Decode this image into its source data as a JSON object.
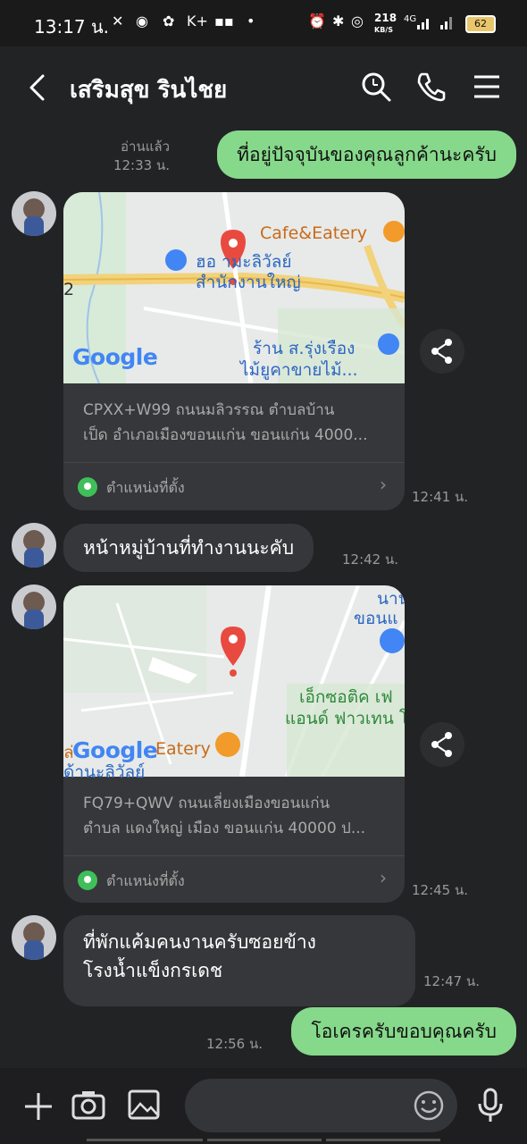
{
  "status_bar": {
    "time": "13:17 น.",
    "net_speed": "218",
    "net_speed_unit": "KB/S",
    "net_type": "4G",
    "battery": "62"
  },
  "header": {
    "title": "เสริมสุข   รินไชย"
  },
  "messages": {
    "m1": {
      "text": "ที่อยู่ปัจจุบันของคุณลูกค้านะครับ",
      "read": "อ่านแล้ว",
      "time": "12:33 น."
    },
    "m2": {
      "address_line1": "CPXX+W99 ถนนมลิวรรณ ตำบลบ้าน",
      "address_line2": "เป็ด อำเภอเมืองขอนแก่น ขอนแก่น 4000...",
      "location_label": "ตำแหน่งที่ตั้ง",
      "time": "12:41 น.",
      "map_labels": {
        "cafe": "Cafe&Eatery",
        "place1a": "ฮอ  ามะลิวัลย์",
        "place1b": "สำนักงานใหญ่",
        "shop1": "ร้าน ส.รุ่งเรือง",
        "shop2": "ไม้ยูคาขายไม้...",
        "road": "2",
        "brand": "Google"
      }
    },
    "m3": {
      "text": "หน้าหมู่บ้านที่ทำงานนะคับ",
      "time": "12:42 น."
    },
    "m4": {
      "address_line1": "FQ79+QWV ถนนเลี่ยงเมืองขอนแก่น",
      "address_line2": "ตำบล แดงใหญ่ เมือง ขอนแก่น 40000 ป...",
      "location_label": "ตำแหน่งที่ตั้ง",
      "time": "12:45 น.",
      "map_labels": {
        "top1": "นานา",
        "top2": "ขอนแ",
        "brand1": "เอ็กซอติค เฟ",
        "brand2": "แอนด์ ฟาวเทน โ",
        "eatery": "Eatery",
        "cut": "ล่",
        "cut2": "ด้านะลิวัลย์",
        "brand": "Google"
      }
    },
    "m5": {
      "line1": "ที่พักแค้มคนงานครับซอยข้าง",
      "line2": "โรงน้ำแข็งกรเดช",
      "time": "12:47 น."
    },
    "m6": {
      "text": "โอเครครับขอบคุณครับ",
      "time": "12:56 น."
    }
  },
  "composer": {
    "placeholder": ""
  },
  "colors": {
    "accent_green": "#86d98b",
    "background": "#222325",
    "bubble_in": "#36373a"
  }
}
